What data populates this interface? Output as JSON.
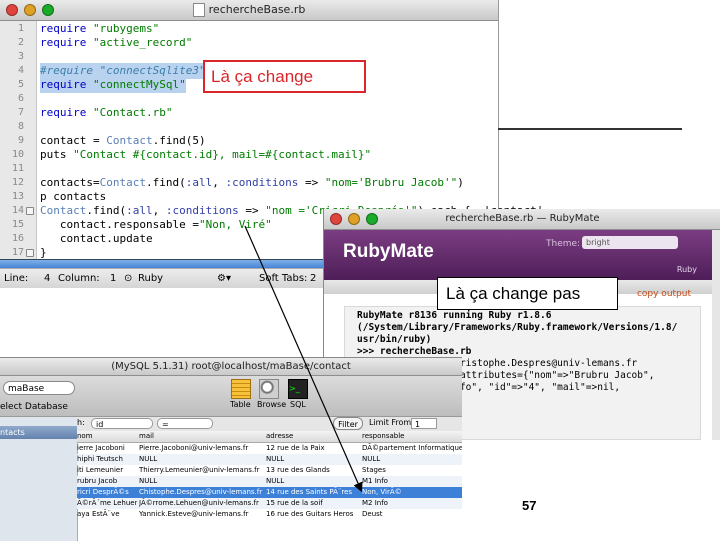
{
  "editor": {
    "title": "rechercheBase.rb",
    "lines": [
      {
        "n": "1",
        "parts": [
          [
            "k-req",
            "require "
          ],
          [
            "k-str",
            "\"rubygems\""
          ]
        ]
      },
      {
        "n": "2",
        "parts": [
          [
            "k-req",
            "require "
          ],
          [
            "k-str",
            "\"active_record\""
          ]
        ]
      },
      {
        "n": "3",
        "parts": []
      },
      {
        "n": "4",
        "hl": true,
        "parts": [
          [
            "k-cmt",
            "#require \"connectSqlite3\""
          ]
        ]
      },
      {
        "n": "5",
        "hl": true,
        "parts": [
          [
            "k-req",
            "require "
          ],
          [
            "k-str",
            "\"connectMySql\""
          ]
        ]
      },
      {
        "n": "6",
        "parts": []
      },
      {
        "n": "7",
        "parts": [
          [
            "k-req",
            "require "
          ],
          [
            "k-str",
            "\"Contact.rb\""
          ]
        ]
      },
      {
        "n": "8",
        "parts": []
      },
      {
        "n": "9",
        "parts": [
          [
            "",
            "contact = "
          ],
          [
            "k-const",
            "Contact"
          ],
          [
            "",
            ".find(5)"
          ]
        ]
      },
      {
        "n": "10",
        "parts": [
          [
            "",
            "puts "
          ],
          [
            "k-str",
            "\"Contact #{contact.id}, mail=#{contact.mail}\""
          ]
        ]
      },
      {
        "n": "11",
        "parts": []
      },
      {
        "n": "12",
        "parts": [
          [
            "",
            "contacts="
          ],
          [
            "k-const",
            "Contact"
          ],
          [
            "",
            ".find("
          ],
          [
            "k-sym",
            ":all"
          ],
          [
            "",
            ", "
          ],
          [
            "k-sym",
            ":conditions"
          ],
          [
            "",
            " => "
          ],
          [
            "k-str",
            "\"nom='Brubru Jacob'\""
          ],
          [
            "",
            ")"
          ]
        ]
      },
      {
        "n": "13",
        "parts": [
          [
            "",
            "p contacts"
          ]
        ]
      },
      {
        "n": "14",
        "fold": true,
        "parts": [
          [
            "k-const",
            "Contact"
          ],
          [
            "",
            ".find("
          ],
          [
            "k-sym",
            ":all"
          ],
          [
            "",
            ", "
          ],
          [
            "k-sym",
            ":conditions"
          ],
          [
            "",
            " => "
          ],
          [
            "k-str",
            "\"nom ='Cricri Després'\""
          ],
          [
            "",
            ").each {  |contact|"
          ]
        ]
      },
      {
        "n": "15",
        "parts": [
          [
            "",
            "   contact.responsable ="
          ],
          [
            "k-str",
            "\"Non, Viré\""
          ]
        ]
      },
      {
        "n": "16",
        "parts": [
          [
            "",
            "   contact.update"
          ]
        ]
      },
      {
        "n": "17",
        "fold": true,
        "parts": [
          [
            "",
            "}"
          ]
        ]
      }
    ],
    "status": {
      "line_label": "Line:",
      "line_value": "4",
      "column_label": "Column:",
      "column_value": "1",
      "language": "Ruby",
      "tabs_label": "Soft Tabs:",
      "tabs_value": "2"
    }
  },
  "callout_top": "Là ça change",
  "callout_bottom": "Là ça change pas",
  "rubymate": {
    "title": "rechercheBase.rb — RubyMate",
    "logo": "RubyMate",
    "theme_label": "Theme:",
    "theme_value": "bright",
    "ruby_label": "Ruby",
    "copy_output": "copy output",
    "output": [
      {
        "bold": true,
        "text": "RubyMate r8136 running Ruby r1.8.6"
      },
      {
        "bold": true,
        "text": "(/System/Library/Frameworks/Ruby.framework/Versions/1.8/"
      },
      {
        "bold": true,
        "text": "usr/bin/ruby)"
      },
      {
        "bold": true,
        "text": ">>> rechercheBase.rb"
      },
      {
        "bold": false,
        "text": ""
      },
      {
        "bold": false,
        "text": "Contact 5, mail=Christophe.Despres@univ-lemans.fr"
      },
      {
        "bold": false,
        "text": "[#<Contact:0x... @attributes={\"nom\"=>\"Brubru Jacob\","
      },
      {
        "bold": false,
        "text": " \"adresse\"=>\"M1 Info\", \"id\"=>\"4\", \"mail\"=>nil,"
      }
    ]
  },
  "mysql": {
    "title": "(MySQL 5.1.31) root@localhost/maBase/contact",
    "db_value": "maBase",
    "select_db_label": "elect Database",
    "toolbar": {
      "table": "Table",
      "browse": "Browse",
      "sql": "SQL"
    },
    "left_selected": "ntacts",
    "filter": {
      "label": "h:",
      "field": "id",
      "op": "=",
      "button": "Filter",
      "limit_label": "Limit From:",
      "limit_value": "1"
    },
    "columns": [
      "nom",
      "mail",
      "adresse",
      "responsable"
    ],
    "rows": [
      [
        "ierre Jacoboni",
        "Pierre.Jacoboni@univ-lemans.fr",
        "12 rue de la Paix",
        "DÃ©partement Informatique"
      ],
      [
        "hiphi Teutsch",
        "NULL",
        "NULL",
        "NULL"
      ],
      [
        "iti Lemeunier",
        "Thierry.Lemeunier@univ-lemans.fr",
        "13 rue des Glands",
        "Stages"
      ],
      [
        "rubru Jacob",
        "NULL",
        "NULL",
        "M1 Info"
      ],
      [
        "ricri DesprÃ©s",
        "Chistophe.Despres@univ-lemans.fr",
        "14 rue des Saints PÃ¨res",
        "Non, VirÃ©"
      ],
      [
        "Ã©rÃ´me Lehuen",
        "JÃ©rrome.Lehuen@univ-lemans.fr",
        "15 rue de la soif",
        "M2 Info"
      ],
      [
        "aya EstÃ¨ve",
        "Yannick.Esteve@univ-lemans.fr",
        "16 rue des Guitars Heros",
        "Deust"
      ]
    ],
    "selected_row": 4
  },
  "page_number": "57"
}
